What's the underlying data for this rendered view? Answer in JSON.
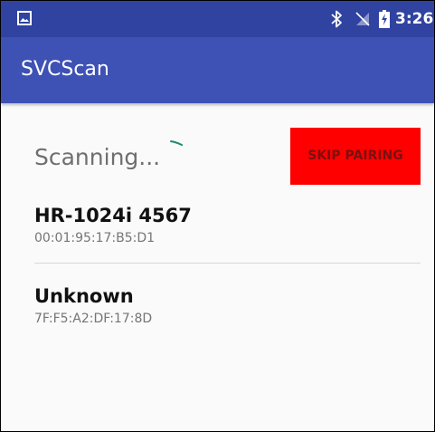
{
  "status_bar": {
    "time": "3:26",
    "icons": [
      "image-icon",
      "bluetooth-icon",
      "no-sim-icon",
      "battery-charging-icon"
    ]
  },
  "app_bar": {
    "title": "SVCScan"
  },
  "main": {
    "scanning_text": "Scanning...",
    "skip_button_label": "SKIP PAIRING",
    "skip_button_color": "#ff0000",
    "devices": [
      {
        "name": "HR-1024i 4567",
        "address": "00:01:95:17:B5:D1"
      },
      {
        "name": "Unknown",
        "address": "7F:F5:A2:DF:17:8D"
      }
    ]
  },
  "colors": {
    "status_bar": "#3043a0",
    "app_bar": "#3e51b5",
    "spinner": "#1e8a72"
  }
}
